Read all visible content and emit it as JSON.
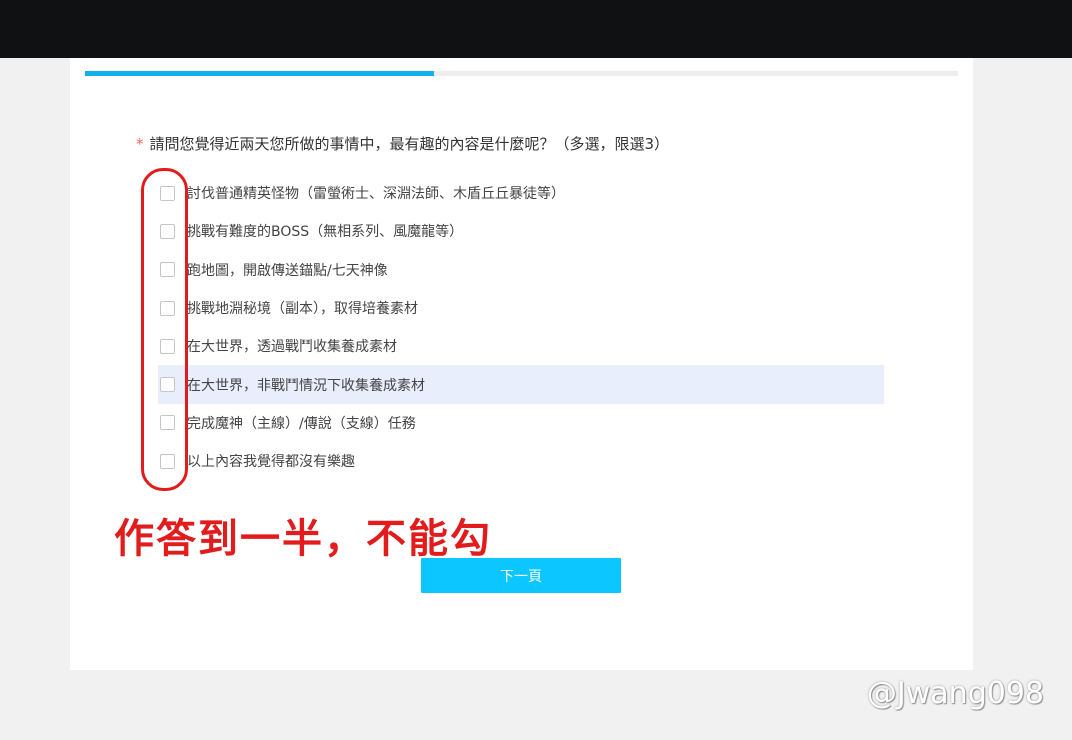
{
  "survey": {
    "progress": 0.4,
    "question": {
      "required_mark": "*",
      "text": "請問您覺得近兩天您所做的事情中，最有趣的內容是什麼呢？（多選，限選3）"
    },
    "options": [
      {
        "label": "討伐普通精英怪物（雷螢術士、深淵法師、木盾丘丘暴徒等）",
        "checked": false
      },
      {
        "label": "挑戰有難度的BOSS（無相系列、風魔龍等）",
        "checked": false
      },
      {
        "label": "跑地圖，開啟傳送錨點/七天神像",
        "checked": false
      },
      {
        "label": "挑戰地淵秘境（副本），取得培養素材",
        "checked": false
      },
      {
        "label": "在大世界，透過戰鬥收集養成素材",
        "checked": false
      },
      {
        "label": "在大世界，非戰鬥情況下收集養成素材",
        "checked": false
      },
      {
        "label": "完成魔神（主線）/傳說（支線）任務",
        "checked": false
      },
      {
        "label": "以上內容我覺得都沒有樂趣",
        "checked": false
      }
    ],
    "next_button": "下一頁"
  },
  "annotation": {
    "text": "作答到一半，不能勾",
    "color": "#e21c1c"
  },
  "watermark": "@Jwang098",
  "colors": {
    "progress": "#0fb0ec",
    "button": "#0cc6ff",
    "highlight": "#e8eefc"
  }
}
